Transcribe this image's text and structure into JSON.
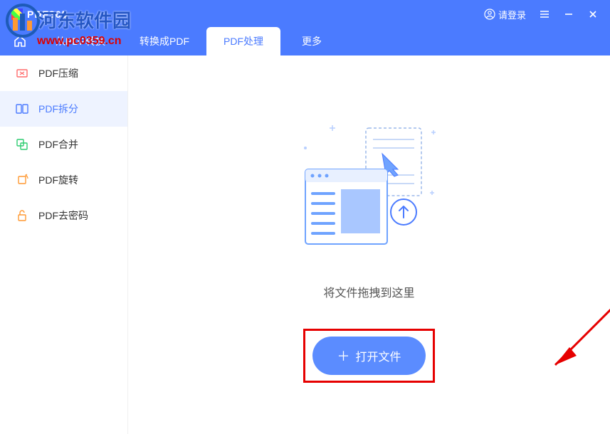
{
  "app": {
    "title": "PDF365"
  },
  "titlebar": {
    "login": "请登录"
  },
  "tabs": {
    "items": [
      {
        "label": "从PDF转换"
      },
      {
        "label": "转换成PDF"
      },
      {
        "label": "PDF处理"
      },
      {
        "label": "更多"
      }
    ]
  },
  "sidebar": {
    "items": [
      {
        "label": "PDF压缩",
        "icon": "compress"
      },
      {
        "label": "PDF拆分",
        "icon": "split"
      },
      {
        "label": "PDF合并",
        "icon": "merge"
      },
      {
        "label": "PDF旋转",
        "icon": "rotate"
      },
      {
        "label": "PDF去密码",
        "icon": "unlock"
      }
    ]
  },
  "main": {
    "drop_hint": "将文件拖拽到这里",
    "open_button": "打开文件"
  },
  "watermark": {
    "site_name": "河东软件园",
    "url": "www.pc0359.cn"
  },
  "colors": {
    "primary": "#4b7bff",
    "accent_red": "#e60000"
  }
}
